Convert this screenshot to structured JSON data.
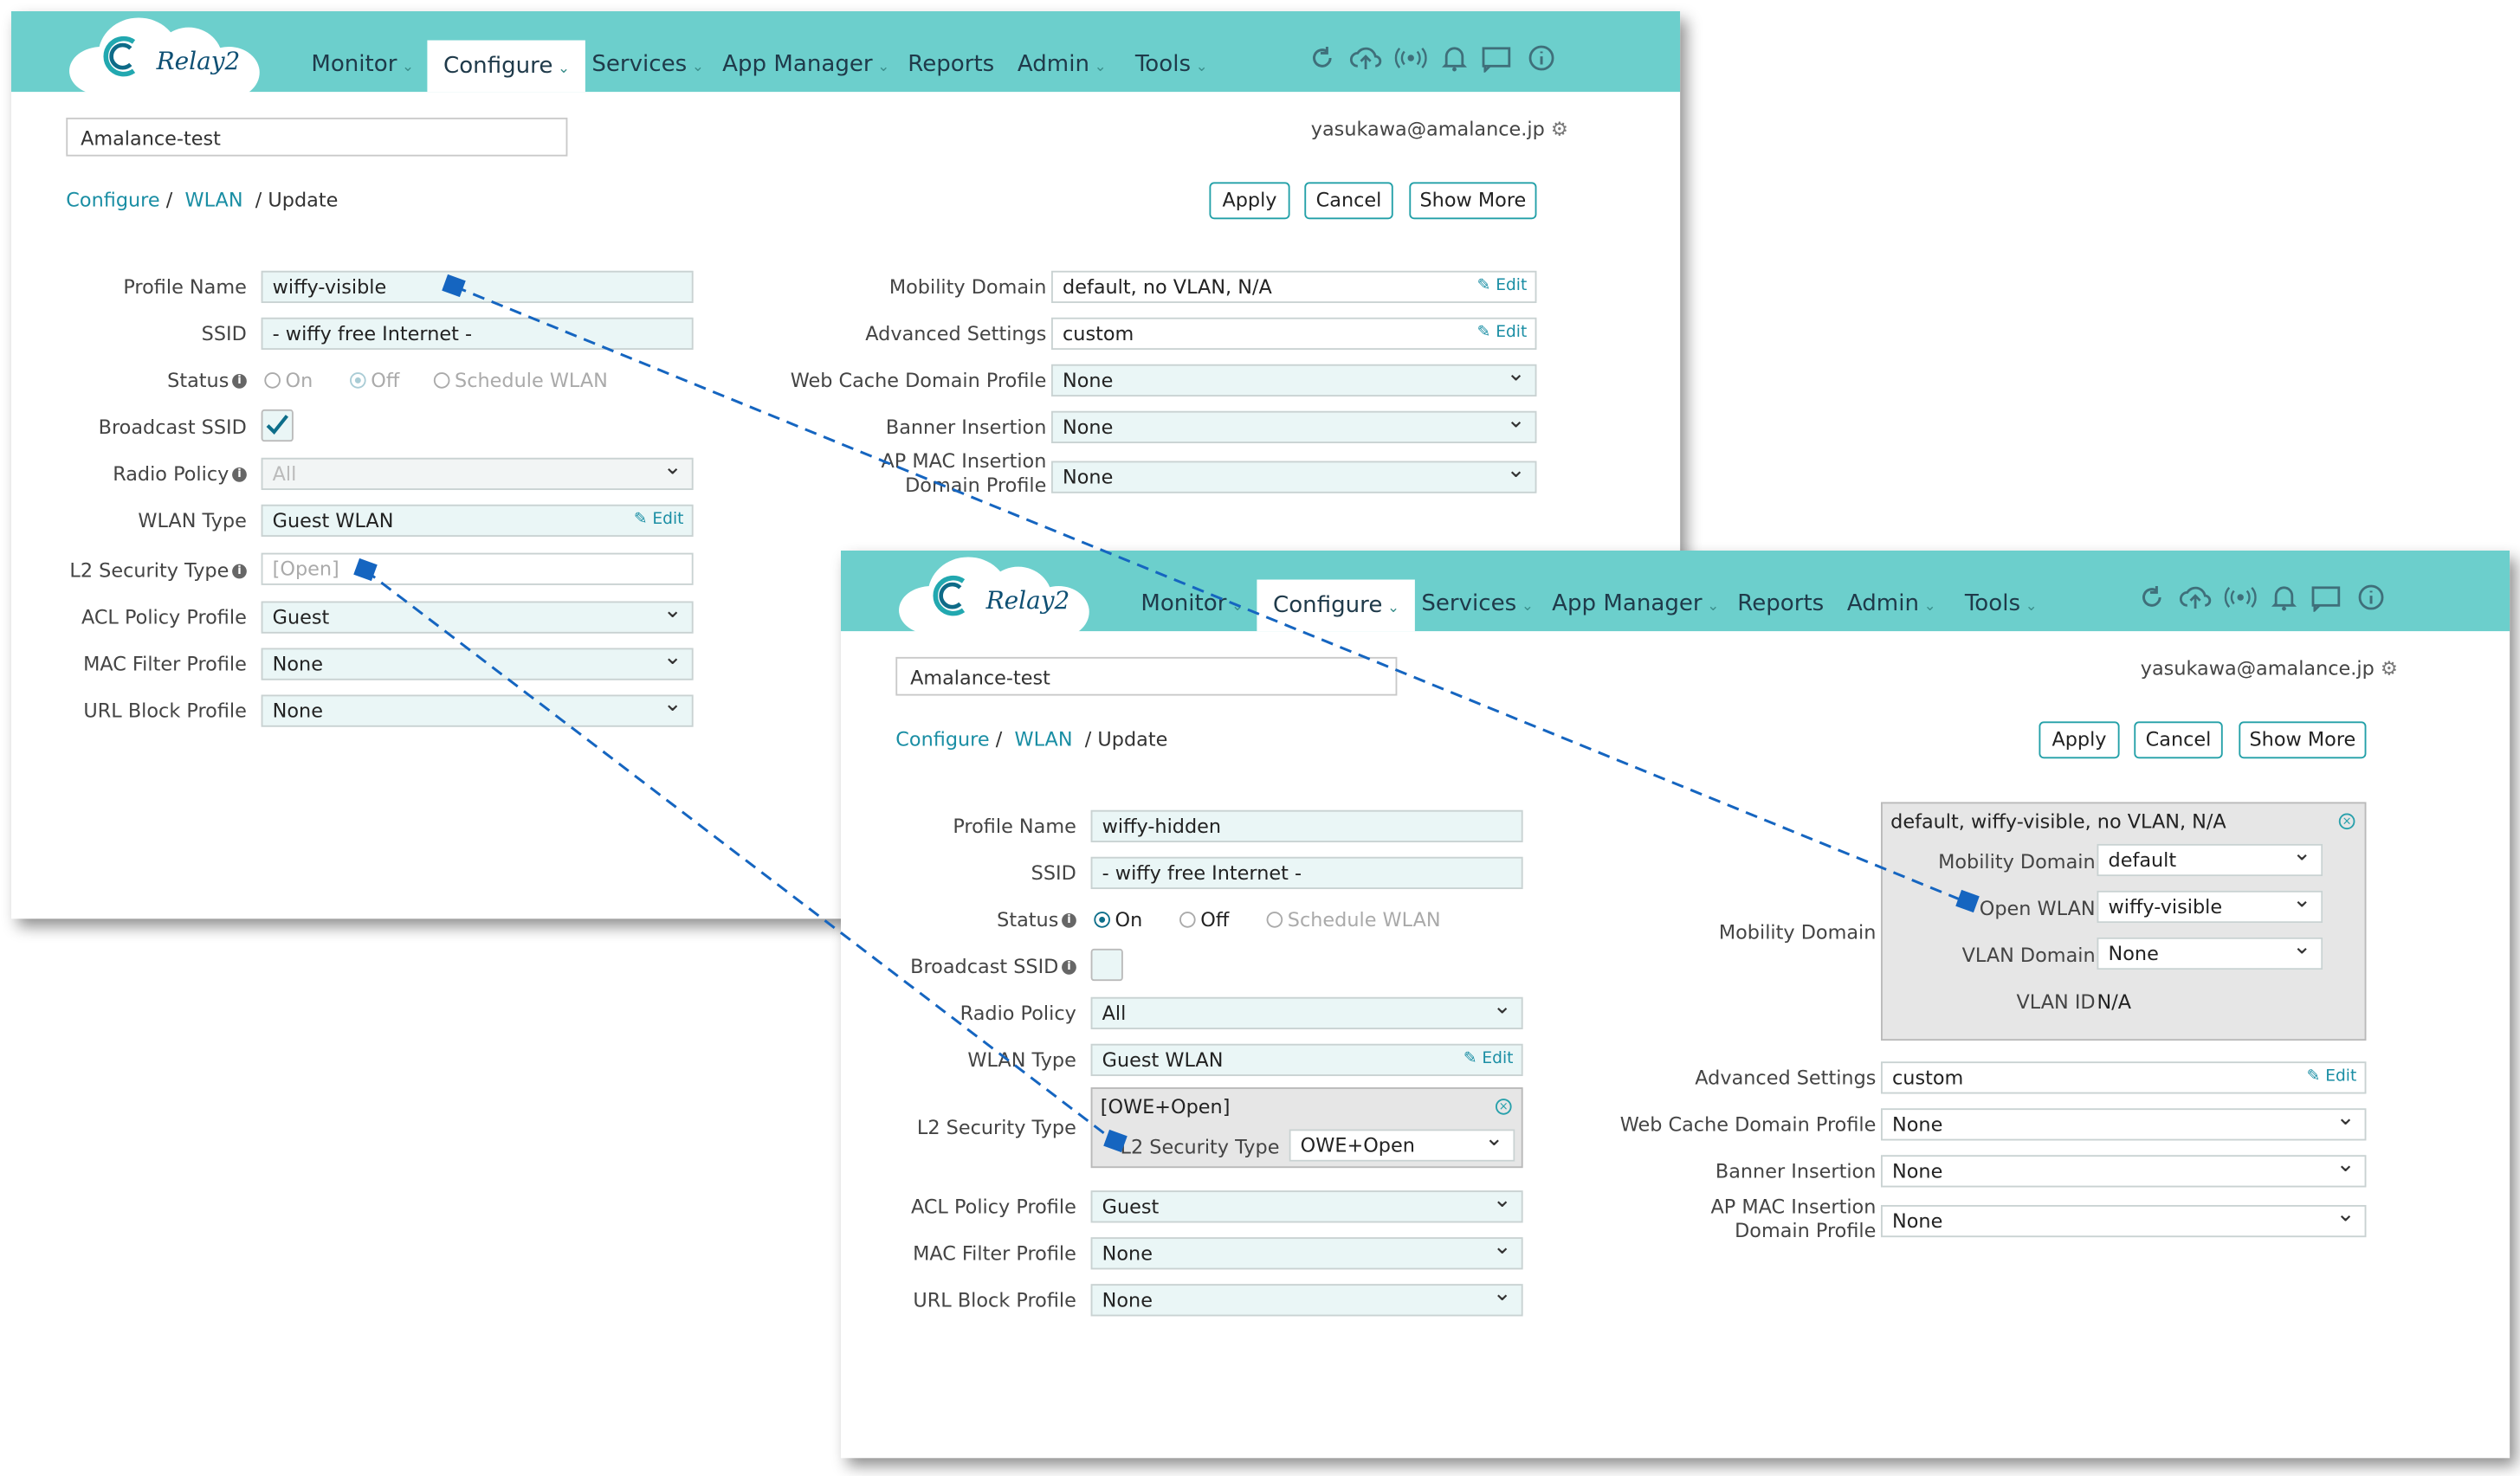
{
  "app": {
    "nav": [
      "Monitor",
      "Configure",
      "Services",
      "App Manager",
      "Reports",
      "Admin",
      "Tools"
    ],
    "logo": "Relay2",
    "org": "Amalance-test",
    "user": "yasukawa@amalance.jp",
    "breadcrumb": {
      "configure": "Configure",
      "wlan": "WLAN",
      "current": "Update"
    },
    "buttons": {
      "apply": "Apply",
      "cancel": "Cancel",
      "show_more": "Show More"
    },
    "edit_label": "Edit"
  },
  "labels": {
    "profile_name": "Profile Name",
    "ssid": "SSID",
    "status": "Status",
    "broadcast_ssid": "Broadcast SSID",
    "radio_policy": "Radio Policy",
    "wlan_type": "WLAN Type",
    "l2_security_type": "L2 Security Type",
    "acl_policy_profile": "ACL Policy Profile",
    "mac_filter_profile": "MAC Filter Profile",
    "url_block_profile": "URL Block Profile",
    "mobility_domain": "Mobility Domain",
    "advanced_settings": "Advanced Settings",
    "web_cache_domain_profile": "Web Cache Domain Profile",
    "banner_insertion": "Banner Insertion",
    "ap_mac_insertion_domain_profile": "AP MAC Insertion Domain Profile",
    "status_on": "On",
    "status_off": "Off",
    "status_schedule": "Schedule WLAN",
    "open_wlan": "Open WLAN",
    "vlan_domain": "VLAN Domain",
    "vlan_id": "VLAN ID"
  },
  "window1": {
    "profile_name": "wiffy-visible",
    "ssid": "- wiffy free Internet -",
    "status": "Off",
    "broadcast_ssid": true,
    "radio_policy": "All",
    "wlan_type": "Guest WLAN",
    "l2_security_type": "[Open]",
    "acl_policy_profile": "Guest",
    "mac_filter_profile": "None",
    "url_block_profile": "None",
    "mobility_domain": "default, no VLAN, N/A",
    "advanced_settings": "custom",
    "web_cache_domain_profile": "None",
    "banner_insertion": "None",
    "ap_mac_insertion_domain_profile": "None"
  },
  "window2": {
    "profile_name": "wiffy-hidden",
    "ssid": "- wiffy free Internet -",
    "status": "On",
    "broadcast_ssid": false,
    "radio_policy": "All",
    "wlan_type": "Guest WLAN",
    "l2_security_summary": "[OWE+Open]",
    "l2_security_type": "OWE+Open",
    "acl_policy_profile": "Guest",
    "mac_filter_profile": "None",
    "url_block_profile": "None",
    "mobility_summary": "default, wiffy-visible, no VLAN, N/A",
    "mobility_domain": "default",
    "open_wlan": "wiffy-visible",
    "vlan_domain": "None",
    "vlan_id": "N/A",
    "advanced_settings": "custom",
    "web_cache_domain_profile": "None",
    "banner_insertion": "None",
    "ap_mac_insertion_domain_profile": "None"
  },
  "colors": {
    "header": "#6ccfcc",
    "accent": "#1a8ea4",
    "connector": "#1565c0"
  }
}
